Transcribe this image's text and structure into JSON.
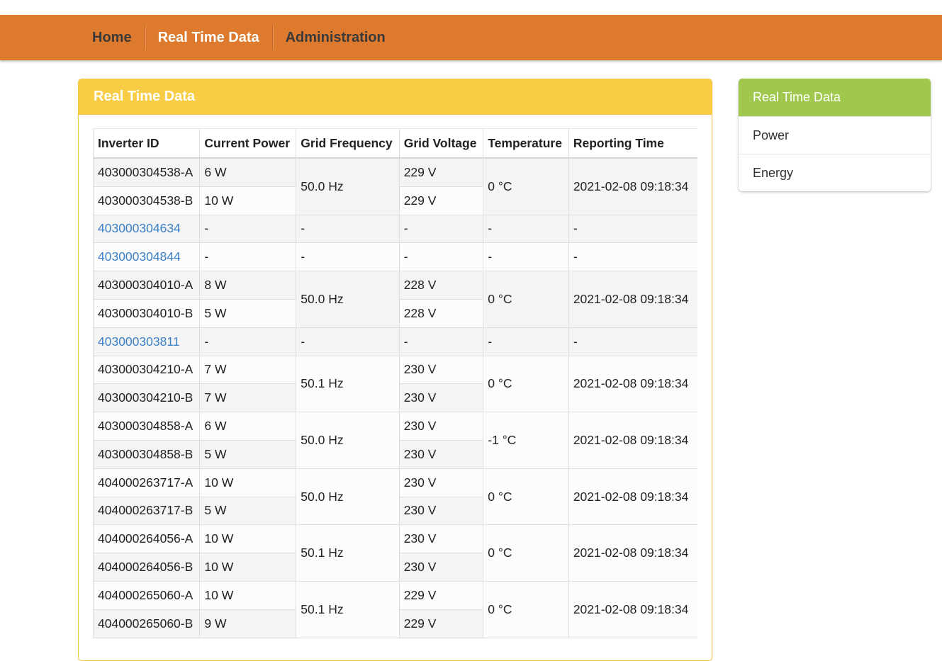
{
  "nav": {
    "items": [
      {
        "label": "Home",
        "active": false
      },
      {
        "label": "Real Time Data",
        "active": true
      },
      {
        "label": "Administration",
        "active": false
      }
    ]
  },
  "panel": {
    "title": "Real Time Data"
  },
  "table": {
    "headers": [
      "Inverter ID",
      "Current Power",
      "Grid Frequency",
      "Grid Voltage",
      "Temperature",
      "Reporting Time"
    ],
    "groups": [
      {
        "rows": [
          {
            "id": "403000304538-A",
            "power": "6 W",
            "voltage": "229 V"
          },
          {
            "id": "403000304538-B",
            "power": "10 W",
            "voltage": "229 V"
          }
        ],
        "frequency": "50.0 Hz",
        "temperature": "0 °C",
        "time": "2021-02-08 09:18:34"
      },
      {
        "link": true,
        "rows": [
          {
            "id": "403000304634",
            "power": "-",
            "voltage": "-"
          }
        ],
        "frequency": "-",
        "temperature": "-",
        "time": "-"
      },
      {
        "link": true,
        "rows": [
          {
            "id": "403000304844",
            "power": "-",
            "voltage": "-"
          }
        ],
        "frequency": "-",
        "temperature": "-",
        "time": "-"
      },
      {
        "rows": [
          {
            "id": "403000304010-A",
            "power": "8 W",
            "voltage": "228 V"
          },
          {
            "id": "403000304010-B",
            "power": "5 W",
            "voltage": "228 V"
          }
        ],
        "frequency": "50.0 Hz",
        "temperature": "0 °C",
        "time": "2021-02-08 09:18:34"
      },
      {
        "link": true,
        "rows": [
          {
            "id": "403000303811",
            "power": "-",
            "voltage": "-"
          }
        ],
        "frequency": "-",
        "temperature": "-",
        "time": "-"
      },
      {
        "rows": [
          {
            "id": "403000304210-A",
            "power": "7 W",
            "voltage": "230 V"
          },
          {
            "id": "403000304210-B",
            "power": "7 W",
            "voltage": "230 V"
          }
        ],
        "frequency": "50.1 Hz",
        "temperature": "0 °C",
        "time": "2021-02-08 09:18:34"
      },
      {
        "rows": [
          {
            "id": "403000304858-A",
            "power": "6 W",
            "voltage": "230 V"
          },
          {
            "id": "403000304858-B",
            "power": "5 W",
            "voltage": "230 V"
          }
        ],
        "frequency": "50.0 Hz",
        "temperature": "-1 °C",
        "time": "2021-02-08 09:18:34"
      },
      {
        "rows": [
          {
            "id": "404000263717-A",
            "power": "10 W",
            "voltage": "230 V"
          },
          {
            "id": "404000263717-B",
            "power": "5 W",
            "voltage": "230 V"
          }
        ],
        "frequency": "50.0 Hz",
        "temperature": "0 °C",
        "time": "2021-02-08 09:18:34"
      },
      {
        "rows": [
          {
            "id": "404000264056-A",
            "power": "10 W",
            "voltage": "230 V"
          },
          {
            "id": "404000264056-B",
            "power": "10 W",
            "voltage": "230 V"
          }
        ],
        "frequency": "50.1 Hz",
        "temperature": "0 °C",
        "time": "2021-02-08 09:18:34"
      },
      {
        "rows": [
          {
            "id": "404000265060-A",
            "power": "10 W",
            "voltage": "229 V"
          },
          {
            "id": "404000265060-B",
            "power": "9 W",
            "voltage": "229 V"
          }
        ],
        "frequency": "50.1 Hz",
        "temperature": "0 °C",
        "time": "2021-02-08 09:18:34"
      }
    ]
  },
  "sidebar": {
    "items": [
      {
        "label": "Real Time Data",
        "active": true
      },
      {
        "label": "Power",
        "active": false
      },
      {
        "label": "Energy",
        "active": false
      }
    ]
  },
  "colors": {
    "nav_bg": "#dd7a2e",
    "panel_header": "#f8cc45",
    "sidebar_active": "#a0c84e",
    "link": "#3b7fc4"
  }
}
